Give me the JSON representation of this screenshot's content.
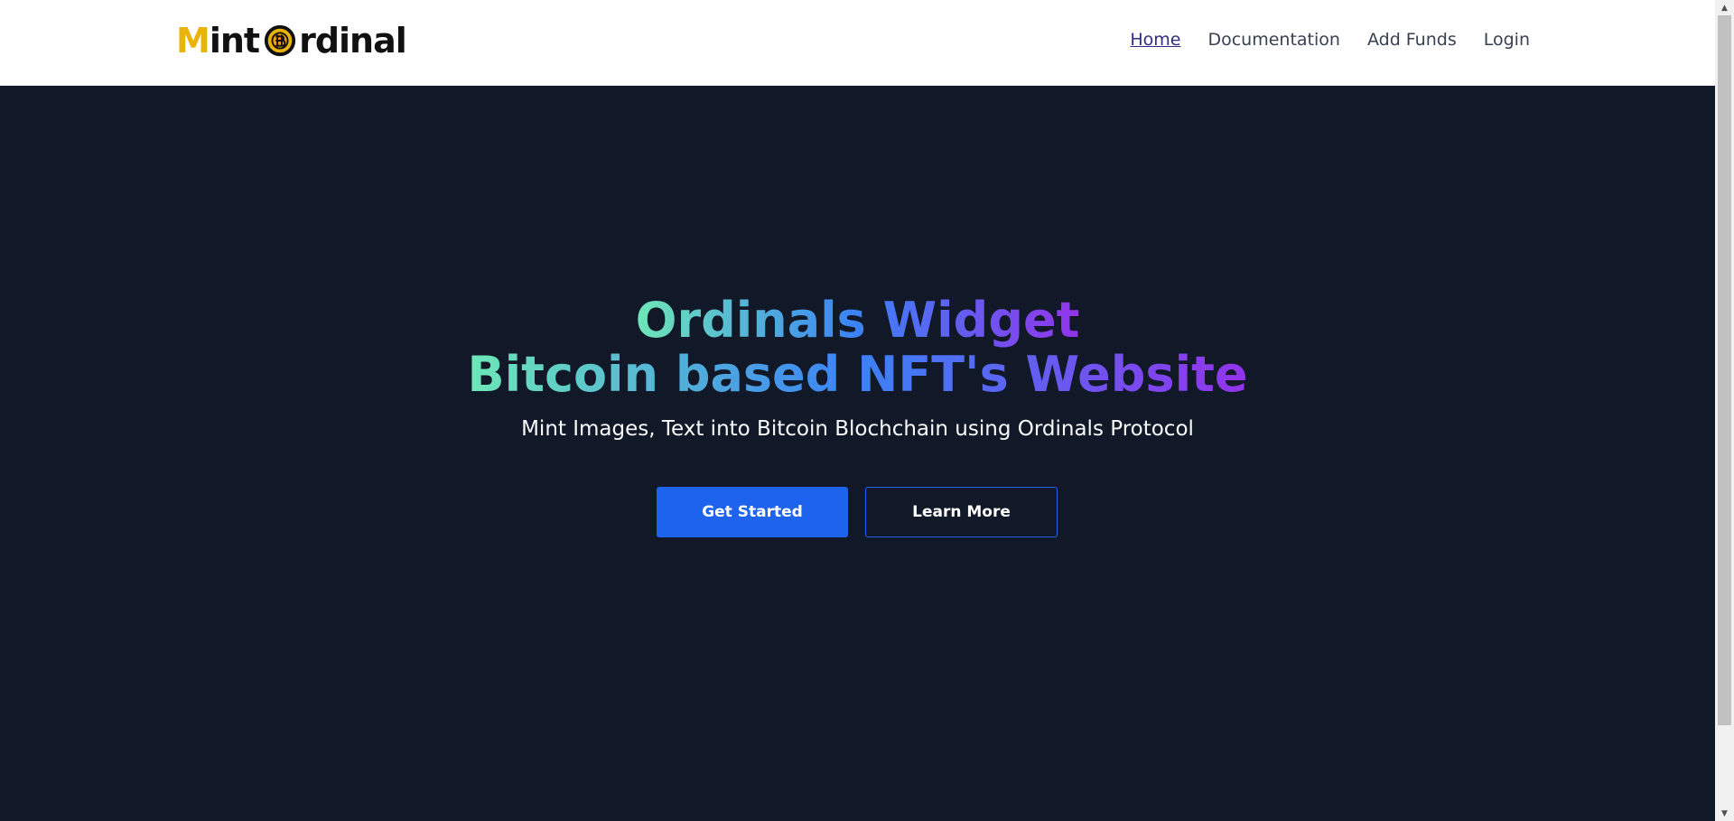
{
  "navbar": {
    "logo": {
      "first_letter": "M",
      "first_rest": "int",
      "second_rest": "rdinal",
      "accent_color": "#eab308"
    },
    "links": [
      {
        "label": "Home",
        "active": true
      },
      {
        "label": "Documentation",
        "active": false
      },
      {
        "label": "Add Funds",
        "active": false
      },
      {
        "label": "Login",
        "active": false
      }
    ]
  },
  "hero": {
    "headline_line1": "Ordinals Widget",
    "headline_line2": "Bitcoin based NFT's Website",
    "subtitle": "Mint Images, Text into Bitcoin Blochchain using Ordinals Protocol",
    "primary_button": "Get Started",
    "secondary_button": "Learn More",
    "background_color": "#111827",
    "gradient_colors": [
      "#6ee7b7",
      "#3b82f6",
      "#9333ea"
    ],
    "button_color": "#1d63ed"
  },
  "scrollbar": {
    "up_icon": "arrow-up-icon",
    "down_icon": "arrow-down-icon"
  }
}
